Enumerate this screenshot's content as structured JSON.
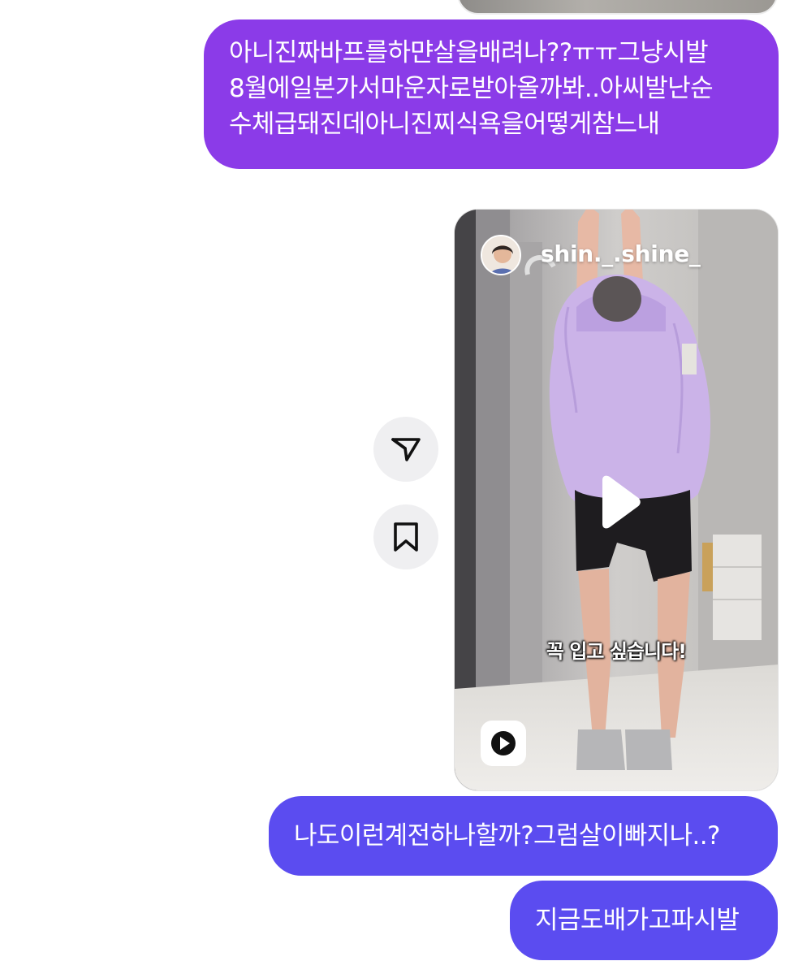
{
  "messages": [
    {
      "lines": [
        "아니진짜바프를하먄살을배려나??ㅠㅠ그냥시발",
        "8월에일본가서마운자로받아올까봐..아씨발난순",
        "수체급돼진데아니진찌식욕을어떻게참느내"
      ],
      "color": "#8b3be8"
    },
    {
      "text": "나도이런계전하나할까?그럼살이빠지나..?",
      "color": "#5b4cf0"
    },
    {
      "text": "지금도배가고파시발",
      "color": "#5b4cf0"
    }
  ],
  "reel": {
    "username": "shin._.shine_",
    "caption": "꼭 입고 싶습니다!",
    "avatar_icon": "profile-avatar",
    "play_icon": "play-icon",
    "badge_icon": "reels-icon"
  },
  "actions": {
    "share_icon": "send-icon",
    "save_icon": "bookmark-icon"
  }
}
